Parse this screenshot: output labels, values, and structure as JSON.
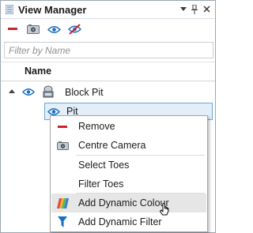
{
  "panel": {
    "title": "View Manager",
    "pin_icon": "pin-icon",
    "dropdown_icon": "dropdown-icon",
    "close_icon": "close-icon"
  },
  "toolbar": {
    "buttons": [
      {
        "icon": "remove-icon",
        "color": "#d0202a"
      },
      {
        "icon": "camera-icon"
      },
      {
        "icon": "eye-icon",
        "color": "#1a6fc0"
      },
      {
        "icon": "hide-icon",
        "color": "#d0202a"
      }
    ]
  },
  "filter": {
    "placeholder": "Filter by Name",
    "value": ""
  },
  "tree": {
    "column_header": "Name",
    "items": [
      {
        "label": "Block Pit",
        "expanded": true,
        "level": 0
      },
      {
        "label": "Pit",
        "selected": true,
        "level": 1
      }
    ]
  },
  "context_menu": {
    "items": [
      {
        "label": "Remove",
        "icon": "remove-icon",
        "color": "#d0202a"
      },
      {
        "label": "Centre Camera",
        "icon": "camera-icon"
      },
      {
        "label": "Select Toes",
        "icon": ""
      },
      {
        "label": "Filter Toes",
        "icon": ""
      },
      {
        "label": "Add Dynamic Colour",
        "icon": "palette-icon",
        "hovered": true
      },
      {
        "label": "Add Dynamic Filter",
        "icon": "funnel-icon",
        "color": "#1a6fc0"
      }
    ]
  }
}
